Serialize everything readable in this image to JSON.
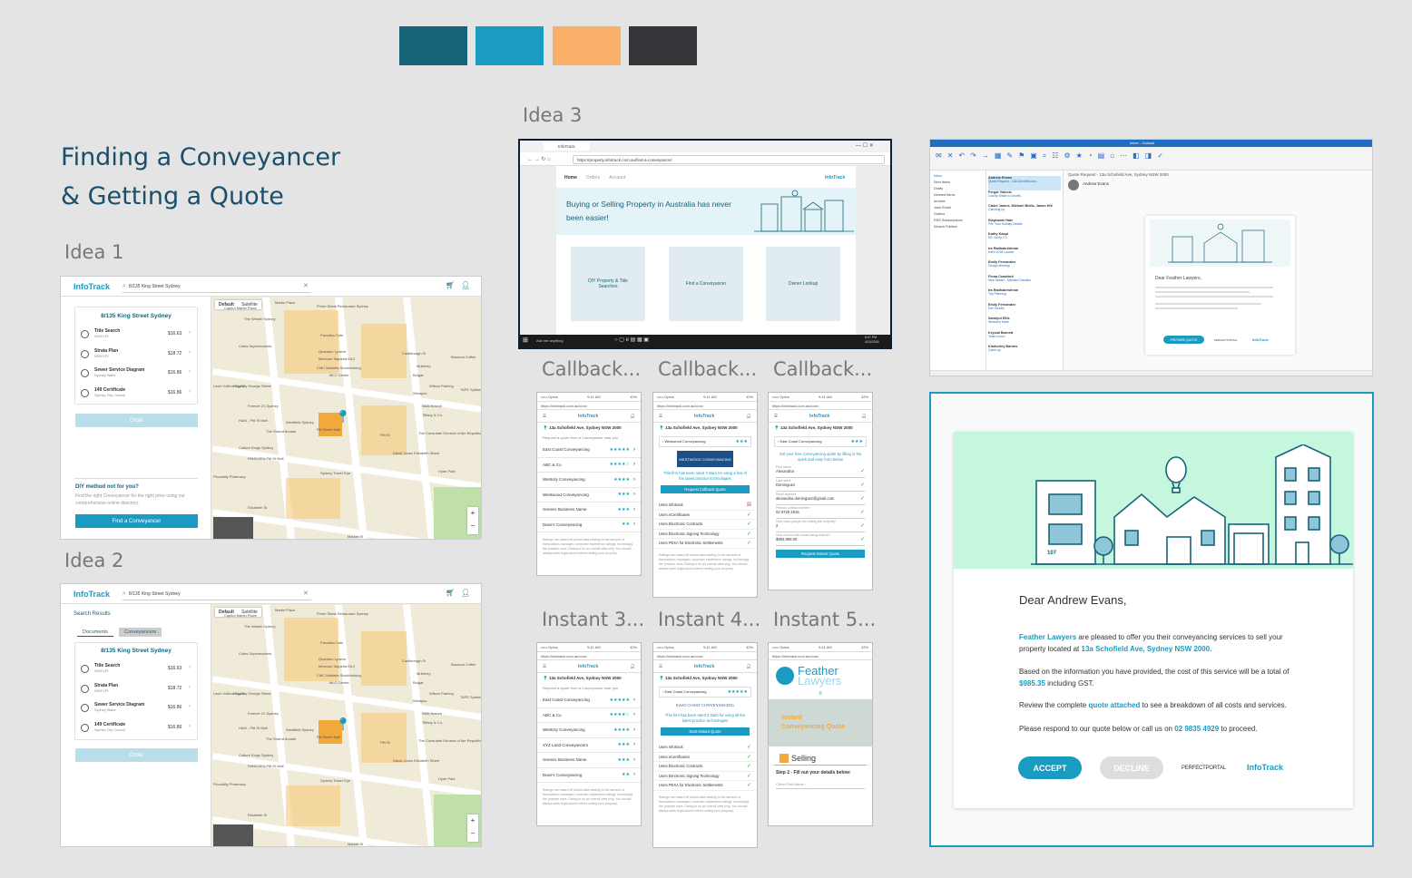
{
  "palette": [
    "#176479",
    "#1a9bc1",
    "#fbb06a",
    "#333538"
  ],
  "title_line1": "Finding a Conveyancer",
  "title_line2": "& Getting a Quote",
  "labels": {
    "idea1": "Idea 1",
    "idea2": "Idea 2",
    "idea3": "Idea 3",
    "callback1": "Callback...",
    "callback2": "Callback...",
    "callback3": "Callback...",
    "instant3": "Instant 3...",
    "instant4": "Instant 4...",
    "instant5": "Instant 5..."
  },
  "idea": {
    "logo": "InfoTrack",
    "search": "8/135 King Street Sydney",
    "address_title": "8/135 King Street Sydney",
    "search_results": "Search Results",
    "tab_documents": "Documents",
    "tab_conveyancers": "Conveyancers",
    "map_default": "Default",
    "map_satellite": "Satellite",
    "order": "Order",
    "diy_title": "DIY method not for you?",
    "diy_text": "Find the right Conveyancer for the right price using our comprehensive online directory.",
    "find_btn": "Find a Conveyancer",
    "items": [
      {
        "name": "Title Search",
        "sub": "NSW LPI",
        "price": "$16.63"
      },
      {
        "name": "Strata Plan",
        "sub": "NSW LPI",
        "price": "$18.72"
      },
      {
        "name": "Sewer Service Diagram",
        "sub": "Sydney Water",
        "price": "$16.86"
      },
      {
        "name": "149 Certificate",
        "sub": "Sydney City Council",
        "price": "$16.86"
      }
    ],
    "map_labels": [
      "Martin Place",
      "Capitol Martin Place",
      "The Westin Sydney",
      "Prime Steak Restaurant Sydney",
      "Paradiso Cafe",
      "Coles Supermarkets",
      "Quantum Lyneve",
      "Mexican Taqueria ML2",
      "CMC Markets Stockbroking",
      "MLC Centre",
      "Lavin Vuitton Sydney George Street",
      "King St",
      "Forever 21 Sydney",
      "H&M - Pitt St Mall",
      "Westfield Sydney",
      "The Strand Arcade",
      "Pitt Street Mall",
      "Culture Kings Sydney",
      "PANDORA Pitt St Mall",
      "Sydney Tower Eye",
      "Piccadilly Pharmacy",
      "David Jones Elizabeth Street",
      "The Consulate General of the Republic of Korea",
      "Hyde Park",
      "Market St",
      "Pitt St",
      "Castlereagh St",
      "Elizabeth St",
      "Westpac",
      "Bulgari",
      "NAB Branch",
      "Tiffany & Co.",
      "Mulberry",
      "Wilson Parking",
      "Brazuca Coffee",
      "TAFE Sydney City"
    ]
  },
  "idea3": {
    "tab": "InfoTrack",
    "url": "https://property.infotrack.com.au/find-a-conveyancer/",
    "nav": [
      "Home",
      "Orders",
      "Account"
    ],
    "logo": "InfoTrack",
    "hero": "Buying or Selling Property in Australia has never been easier!",
    "cards": [
      "DIY Property & Title Searches",
      "Find a Conveyancer",
      "Owner Lookup"
    ],
    "taskbar_search": "Ask me anything",
    "time": "6:07 PM",
    "date": "4/24/2018"
  },
  "outlook": {
    "title": "Inbox - Outlook",
    "email_subject": "Quote Request - 13a Schofield Ave, Sydney NSW 2000",
    "from": "Andrew Evans",
    "greeting": "Dear Feather Lawyers,",
    "button": "PREPARE QUOTE",
    "brand1": "PERFECTPORTAL",
    "brand2": "InfoTrack",
    "folders": [
      "Inbox",
      "Sent Items",
      "Drafts",
      "Deleted Items",
      "Archive",
      "Junk Email",
      "Outbox",
      "RSS Subscriptions",
      "Search Folders"
    ],
    "messages": [
      {
        "from": "Andrew Evans",
        "subject": "Quote Request - 13a Schofield Ave..."
      },
      {
        "from": "Fergal Vidovic",
        "subject": "County Water to unsettl..."
      },
      {
        "from": "Claire James, Michael Biells, Jason Hill",
        "subject": "Catching up"
      },
      {
        "from": "Stephanie Hale",
        "subject": "FW: Your Holiday Details"
      },
      {
        "from": "Kathy Kaspi",
        "subject": "RE: Kerry 2.0"
      },
      {
        "from": "Ira Radhakrishnan",
        "subject": "Hello 2018 Launch"
      },
      {
        "from": "Emily Fernandez",
        "subject": "Design Meeting"
      },
      {
        "from": "Fiona Crawford",
        "subject": "New Starter - Michael Carstairs"
      },
      {
        "from": "Ira Radhakrishnan",
        "subject": "Trip Planning"
      },
      {
        "from": "Emily Fernandez",
        "subject": "Dev Huddle"
      },
      {
        "from": "Sandyul Ellis",
        "subject": "Welcome Mark"
      },
      {
        "from": "Krystal Barnett",
        "subject": "Team Lunch"
      },
      {
        "from": "Kimberley Barnes",
        "subject": "Catch up"
      }
    ]
  },
  "email": {
    "greeting": "Dear Andrew Evans,",
    "firm": "Feather Lawyers",
    "p1_rest": "are pleased to offer you their conveyancing services to sell your property located at",
    "address": "13a Schofield Ave, Sydney NSW 2000.",
    "p2_start": "Based on the information you have provided, the cost of this service will be a total of",
    "amount": "$985.35",
    "p2_end": "including GST.",
    "p3_start": "Review the complete",
    "p3_link": "quote attached",
    "p3_end": "to see a breakdown of all costs and services.",
    "p4_start": "Please respond to our quote below or call us on",
    "phone": "02 9835 4929",
    "p4_end": "to proceed.",
    "accept": "ACCEPT",
    "decline": "DECLINE",
    "brand1": "PERFECTPORTAL",
    "brand2": "InfoTrack",
    "house_number": "107"
  },
  "phones": {
    "status_left": "••••• Optus",
    "time": "9:41 AM",
    "battery": "42%",
    "url": "https://infotrack.com.au/conv",
    "logo": "InfoTrack",
    "address": "13a Schofield Ave, Sydney NSW 2000",
    "intro": "Request a quote from a Conveyancer near you",
    "footnote": "Ratings are based off actual data relating to the amount of transactions managed, customer experience ratings, technology the practice uses. Rating is for an overall view only. You should always seek legal advice before selling your property.",
    "list1": [
      {
        "name": "East Coast Conveyancing",
        "stars": "★★★★★"
      },
      {
        "name": "ABC & Co",
        "stars": "★★★★☆"
      },
      {
        "name": "Westcity Conveyancing",
        "stars": "★★★★"
      },
      {
        "name": "Westwood Conveyancing",
        "stars": "★★★"
      },
      {
        "name": "Generic Business Name",
        "stars": "★★★"
      },
      {
        "name": "Dave's Conveyancing",
        "stars": "★★"
      }
    ],
    "list2": [
      {
        "name": "East Coast Conveyancing",
        "stars": "★★★★★"
      },
      {
        "name": "ABC & Co",
        "stars": "★★★★☆"
      },
      {
        "name": "Westcity Conveyancing",
        "stars": "★★★★"
      },
      {
        "name": "XYZ Land Conveyancers",
        "stars": "★★★"
      },
      {
        "name": "Generic Business Name",
        "stars": "★★★"
      },
      {
        "name": "Dave's Conveyancing",
        "stars": "★★"
      }
    ],
    "detail_cb": {
      "name": "Westwood Conveyancing",
      "stars": "★★★",
      "brand": "WESTWOOD CONVEYANCING",
      "rated": "This firm has been rated 3 stars for using a few of the latest practice technologies",
      "btn": "Request Callback Quote"
    },
    "detail_inst": {
      "name": "East Coast Conveyancing",
      "stars": "★★★★★",
      "brand": "EAST COAST CONVEYANCING",
      "rated": "This firm has been rated 5 stars for using all the latest practice technologies",
      "btn": "Start Instant Quote"
    },
    "features": [
      "Uses Infotrack",
      "Uses eCertificates",
      "Uses Electronic Contracts",
      "Uses Electronic Signing Technology",
      "Uses PEXA for Electronic Settlements"
    ],
    "form": {
      "name": "East Coast Conveyancing",
      "stars": "★★★",
      "intro": "Get your free conveyancing quote by filling in the quick and easy form below",
      "fields": [
        {
          "label": "First name",
          "value": "Alexandria"
        },
        {
          "label": "Last name",
          "value": "Dominguez"
        },
        {
          "label": "Email address",
          "value": "alexandria.dominguez@gmail.com"
        },
        {
          "label": "Primary contact number",
          "value": "02 9725 2816"
        },
        {
          "label": "How many people are selling the property?",
          "value": "2"
        },
        {
          "label": "How much is the house being sold for?",
          "value": "$894,999.00"
        }
      ],
      "btn": "Request Instant Quote"
    },
    "feather": {
      "brand1": "Feather",
      "brand2": "Lawyers",
      "banner1": "Instant",
      "banner2": "Conveyancing Quote",
      "section": "Selling",
      "step": "Step 2 - Fill out your details below:",
      "field": "Client First Name *"
    }
  }
}
